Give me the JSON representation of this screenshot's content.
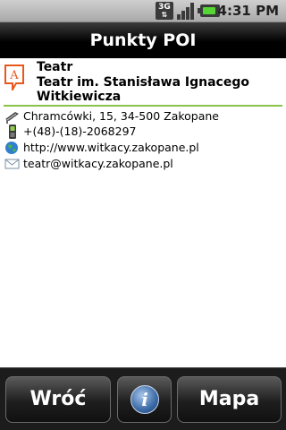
{
  "status_bar": {
    "network_label": "3G",
    "time": "4:31 PM",
    "icons": [
      "3g-icon",
      "signal-icon",
      "battery-icon"
    ]
  },
  "title_bar": {
    "title": "Punkty POI"
  },
  "poi": {
    "category": "Teatr",
    "name": "Teatr im. Stanisława Ignacego Witkiewicza",
    "category_icon": "theatre-pin-icon",
    "details": [
      {
        "icon": "road-sign-icon",
        "text": "Chramcówki, 15, 34-500 Zakopane"
      },
      {
        "icon": "phone-icon",
        "text": "+(48)-(18)-2068297"
      },
      {
        "icon": "globe-icon",
        "text": "http://www.witkacy.zakopane.pl"
      },
      {
        "icon": "envelope-icon",
        "text": "teatr@witkacy.zakopane.pl"
      }
    ]
  },
  "bottom_bar": {
    "back_label": "Wróć",
    "info_label": "i",
    "map_label": "Mapa"
  },
  "colors": {
    "accent_divider": "#8bc34a",
    "title_bar": "#000000",
    "poi_pin": "#e8581c"
  }
}
